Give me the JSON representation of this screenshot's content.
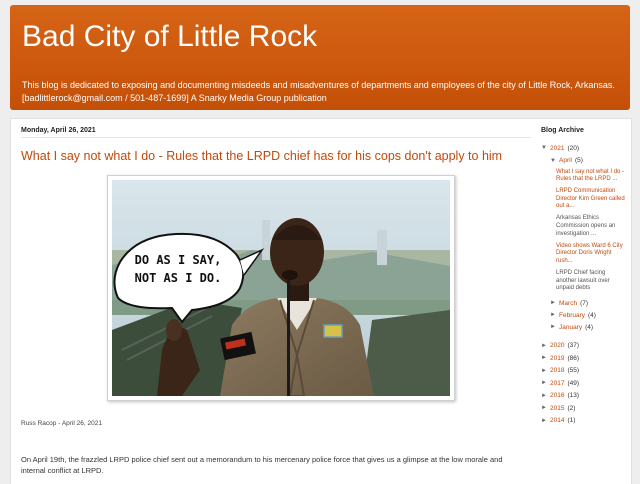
{
  "header": {
    "title": "Bad City of Little Rock",
    "description": "This blog is dedicated to exposing and documenting misdeeds and misadventures of departments and employees of the city of Little Rock, Arkansas. [badlittlerock@gmail.com / 501-487-1699] A Snarky Media Group publication"
  },
  "post": {
    "date": "Monday, April 26, 2021",
    "title": "What I say not what I do - Rules that the LRPD chief has for his cops don't apply to him",
    "speech_bubble_line1": "DO AS I SAY,",
    "speech_bubble_line2": "NOT AS I DO.",
    "byline": "Russ Racop - April 26, 2021",
    "body": "On April 19th, the frazzled LRPD police chief sent out a memorandum to his mercenary police force that gives us a glimpse at the low morale and internal conflict at LRPD."
  },
  "sidebar": {
    "heading": "Blog Archive",
    "current_year": {
      "label": "2021",
      "count": "(20)"
    },
    "current_month": {
      "label": "April",
      "count": "(5)"
    },
    "month_posts": [
      "What I say not what I do - Rules that the LRPD ...",
      "LRPD Communication Director Kim Green called out a...",
      "Arkansas Ethics Commission opens an investigation ...",
      "Video shows Ward 6 City Director Doris Wright rush...",
      "LRPD Chief facing another lawsuit over unpaid debts"
    ],
    "other_months": [
      {
        "label": "March",
        "count": "(7)"
      },
      {
        "label": "February",
        "count": "(4)"
      },
      {
        "label": "January",
        "count": "(4)"
      }
    ],
    "years": [
      {
        "label": "2020",
        "count": "(37)"
      },
      {
        "label": "2019",
        "count": "(86)"
      },
      {
        "label": "2018",
        "count": "(55)"
      },
      {
        "label": "2017",
        "count": "(49)"
      },
      {
        "label": "2016",
        "count": "(13)"
      },
      {
        "label": "2015",
        "count": "(2)"
      },
      {
        "label": "2014",
        "count": "(1)"
      }
    ]
  },
  "colors": {
    "header_bg": "#c8550a",
    "link": "#c04a0a",
    "page_bg": "#eeeeee"
  }
}
